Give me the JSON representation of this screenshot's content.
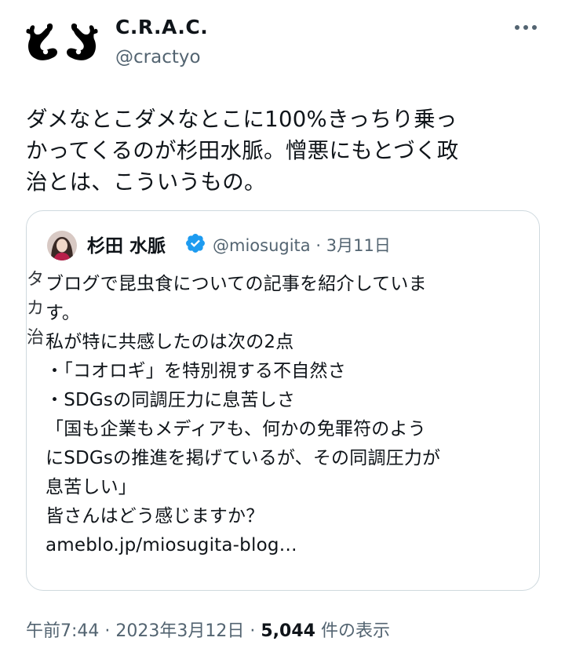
{
  "author": {
    "display_name": "C.R.A.C.",
    "handle": "@cractyo",
    "avatar_icon": "hand-gesture-logo-icon"
  },
  "tweet": {
    "lines": [
      "ダメなとこダメなとこに100%きっちり乗っ",
      "かってくるのが杉田水脈。憎悪にもとづく政",
      "治とは、こういうもの。"
    ]
  },
  "quote": {
    "display_name": "杉田 水脈",
    "handle": "@miosugita",
    "separator": "·",
    "date": "3月11日",
    "verified_icon": "verified-badge-icon",
    "lines": [
      "ブログで昆虫食についての記事を紹介していま",
      "す。",
      "私が特に共感したのは次の2点",
      "・「コオロギ」を特別視する不自然さ",
      "・SDGsの同調圧力に息苦しさ",
      "「国も企業もメディアも、何かの免罪符のよう",
      "にSDGsの推進を掲げているが、その同調圧力が",
      "息苦しい」",
      "皆さんはどう感じますか？"
    ],
    "link": "ameblo.jp/miosugita-blog…"
  },
  "ghost_chars": [
    "タ",
    "カ",
    "治"
  ],
  "footer": {
    "time": "午前7:44",
    "sep1": " · ",
    "date": "2023年3月12日",
    "sep2": " · ",
    "views_count": "5,044",
    "views_label": " 件の表示"
  },
  "colors": {
    "text": "#0f1419",
    "secondary": "#536471",
    "verified": "#1d9bf0",
    "border": "#cfd9de"
  }
}
